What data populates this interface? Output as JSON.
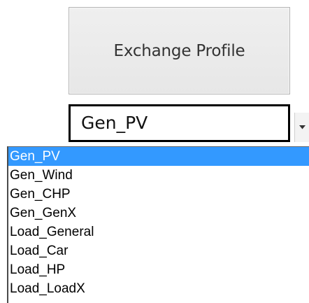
{
  "exchange_button": {
    "label": "Exchange Profile"
  },
  "profile_combo": {
    "selected_value": "Gen_PV",
    "arrow_icon": "dropdown-arrow-icon"
  },
  "dropdown": {
    "selected_index": 0,
    "selection_color": "#3399ff",
    "options": [
      "Gen_PV",
      "Gen_Wind",
      "Gen_CHP",
      "Gen_GenX",
      "Load_General",
      "Load_Car",
      "Load_HP",
      "Load_LoadX"
    ]
  }
}
